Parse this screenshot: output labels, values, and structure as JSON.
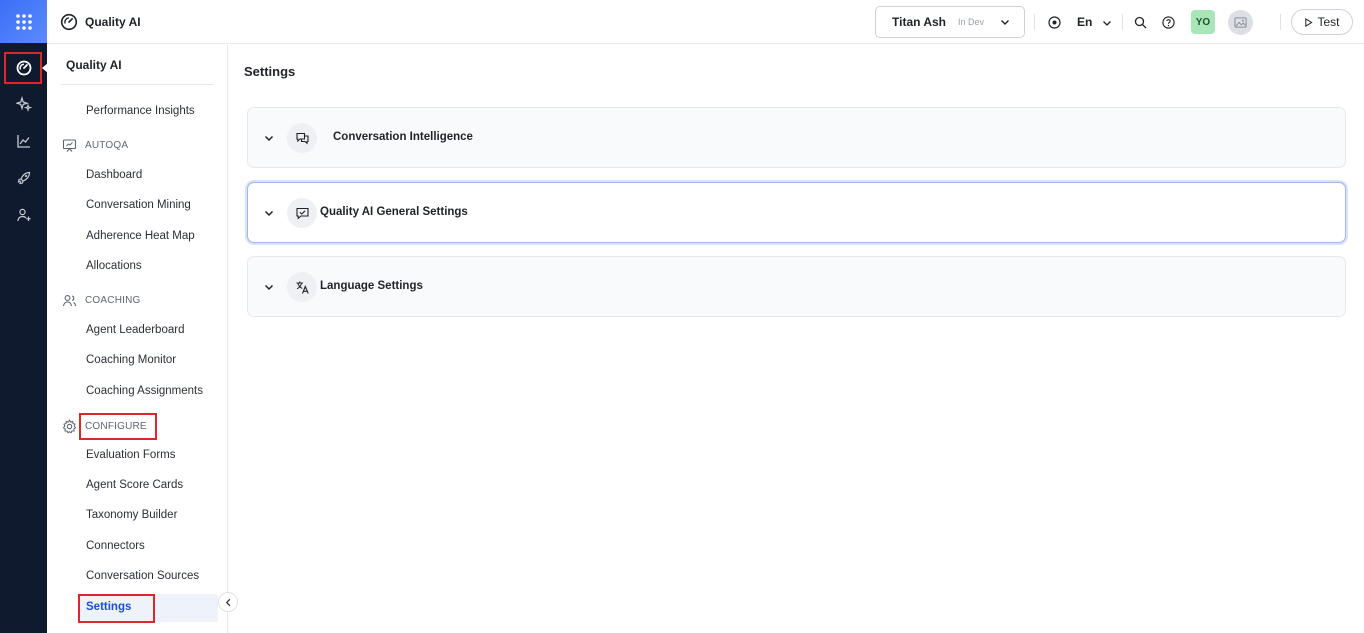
{
  "app": {
    "title": "Quality AI"
  },
  "topbar": {
    "env_name": "Titan Ash",
    "env_tag": "In Dev",
    "language": "En",
    "avatar_initials": "YO",
    "test_label": "Test"
  },
  "sidebar": {
    "header": "Quality AI",
    "items_top": [
      "Performance Insights"
    ],
    "sections": [
      {
        "label": "AUTOQA",
        "items": [
          "Dashboard",
          "Conversation Mining",
          "Adherence Heat Map",
          "Allocations"
        ]
      },
      {
        "label": "COACHING",
        "items": [
          "Agent Leaderboard",
          "Coaching Monitor",
          "Coaching Assignments"
        ]
      },
      {
        "label": "CONFIGURE",
        "items": [
          "Evaluation Forms",
          "Agent Score Cards",
          "Taxonomy Builder",
          "Connectors",
          "Conversation Sources",
          "Settings"
        ]
      }
    ]
  },
  "main": {
    "title": "Settings",
    "panels": [
      {
        "label": "Conversation Intelligence"
      },
      {
        "label": "Quality AI General Settings"
      },
      {
        "label": "Language Settings"
      }
    ]
  },
  "colors": {
    "rail": "#0f1a2e",
    "accent": "#1a4fd6",
    "highlight": "#e0262a",
    "avatar": "#a8e6b8"
  }
}
